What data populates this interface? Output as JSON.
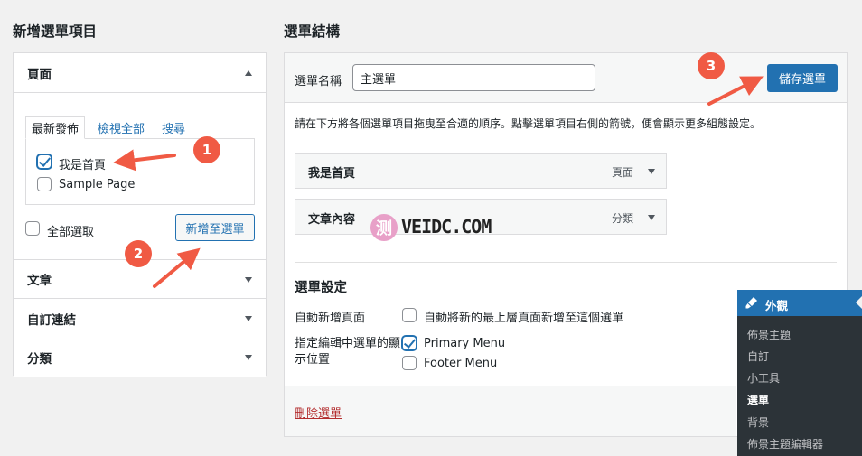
{
  "left": {
    "heading": "新增選單項目",
    "pages_section": {
      "title": "頁面",
      "tabs": [
        "最新發佈",
        "檢視全部",
        "搜尋"
      ],
      "items": [
        {
          "label": "我是首頁",
          "checked": true
        },
        {
          "label": "Sample Page",
          "checked": false
        }
      ],
      "select_all_label": "全部選取",
      "add_button": "新增至選單"
    },
    "sections": [
      "文章",
      "自訂連結",
      "分類"
    ]
  },
  "right": {
    "heading": "選單結構",
    "menu_name_label": "選單名稱",
    "menu_name_value": "主選單",
    "save_button": "儲存選單",
    "instructions": "請在下方將各個選單項目拖曳至合適的順序。點擊選單項目右側的箭號，便會顯示更多組態設定。",
    "menu_items": [
      {
        "title": "我是首頁",
        "type": "頁面"
      },
      {
        "title": "文章內容",
        "type": "分類"
      }
    ],
    "settings": {
      "heading": "選單設定",
      "auto_add_label": "自動新增頁面",
      "auto_add_option": "自動將新的最上層頁面新增至這個選單",
      "location_label": "指定編輯中選單的顯示位置",
      "locations": [
        {
          "label": "Primary Menu",
          "checked": true
        },
        {
          "label": "Footer Menu",
          "checked": false
        }
      ]
    },
    "delete_link": "刪除選單"
  },
  "watermark": {
    "glyph": "测",
    "text": "VEIDC.COM"
  },
  "badges": [
    "1",
    "2",
    "3"
  ],
  "admin_flyout": {
    "header": "外觀",
    "items": [
      "佈景主題",
      "自訂",
      "小工具",
      "選單",
      "背景",
      "佈景主題編輯器"
    ],
    "current": "選單"
  },
  "colors": {
    "primary": "#2271b1",
    "annotation": "#f05a44",
    "danger": "#b32d2e",
    "admin_dark": "#2c3338"
  }
}
